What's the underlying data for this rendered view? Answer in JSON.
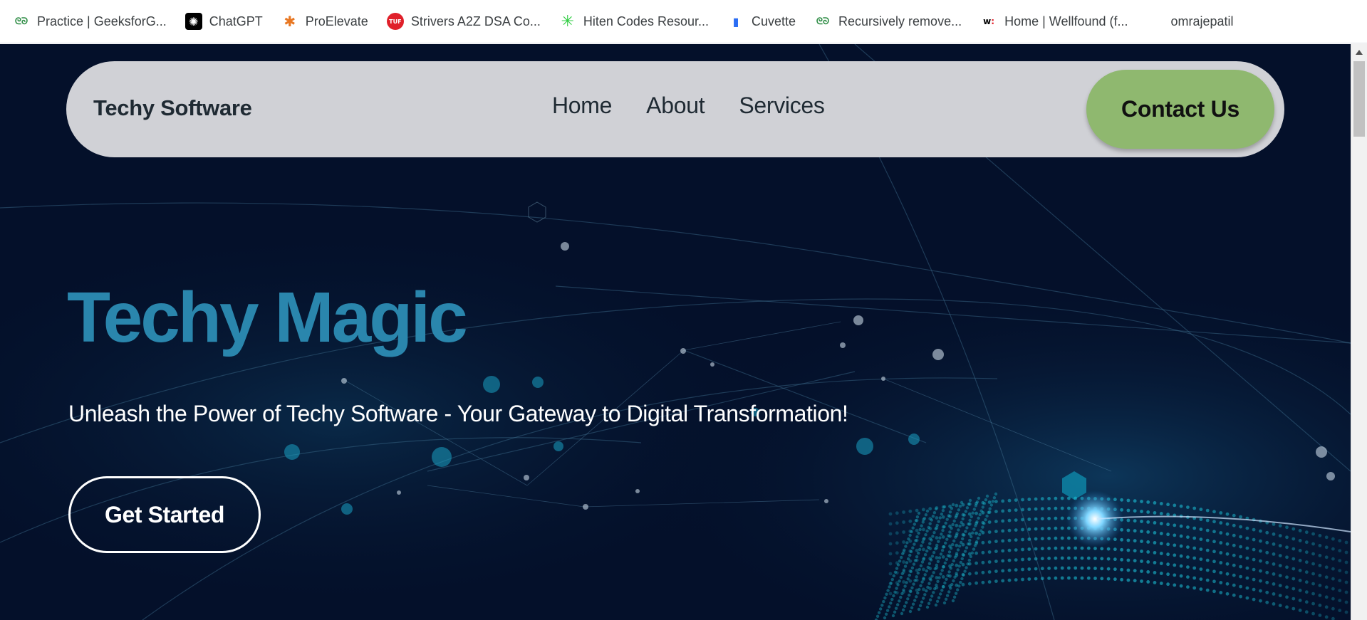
{
  "bookmarks": [
    {
      "label": "Practice | GeeksforG...",
      "icon": "gfg-icon",
      "color": "#2f8d46",
      "glyph": "ᘓᘐ"
    },
    {
      "label": "ChatGPT",
      "icon": "chatgpt-icon",
      "color": "#000000",
      "glyph": "✺"
    },
    {
      "label": "ProElevate",
      "icon": "proelevate-icon",
      "color": "#e87722",
      "glyph": "✱"
    },
    {
      "label": "Strivers A2Z DSA Co...",
      "icon": "tuf-icon",
      "color": "#e0202a",
      "glyph": "TUF"
    },
    {
      "label": "Hiten Codes Resour...",
      "icon": "asterisk-icon",
      "color": "#2ecc40",
      "glyph": "✳"
    },
    {
      "label": "Cuvette",
      "icon": "cuvette-icon",
      "color": "#2a6df4",
      "glyph": "▮"
    },
    {
      "label": "Recursively remove...",
      "icon": "gfg-icon",
      "color": "#2f8d46",
      "glyph": "ᘓᘐ"
    },
    {
      "label": "Home | Wellfound (f...",
      "icon": "wellfound-icon",
      "color": "#000000",
      "glyph": "w:"
    },
    {
      "label": "omrajepatil",
      "icon": "",
      "color": "#ffffff",
      "glyph": ""
    }
  ],
  "navbar": {
    "brand": "Techy Software",
    "links": [
      "Home",
      "About",
      "Services"
    ],
    "contact_label": "Contact Us"
  },
  "hero": {
    "title": "Techy Magic",
    "subtitle": "Unleash the Power of Techy Software - Your Gateway to Digital Transformation!",
    "cta_label": "Get Started"
  },
  "colors": {
    "background": "#04102a",
    "navbar_bg": "#d0d1d6",
    "contact_bg": "#8fb86f",
    "title": "#2a86ad"
  }
}
